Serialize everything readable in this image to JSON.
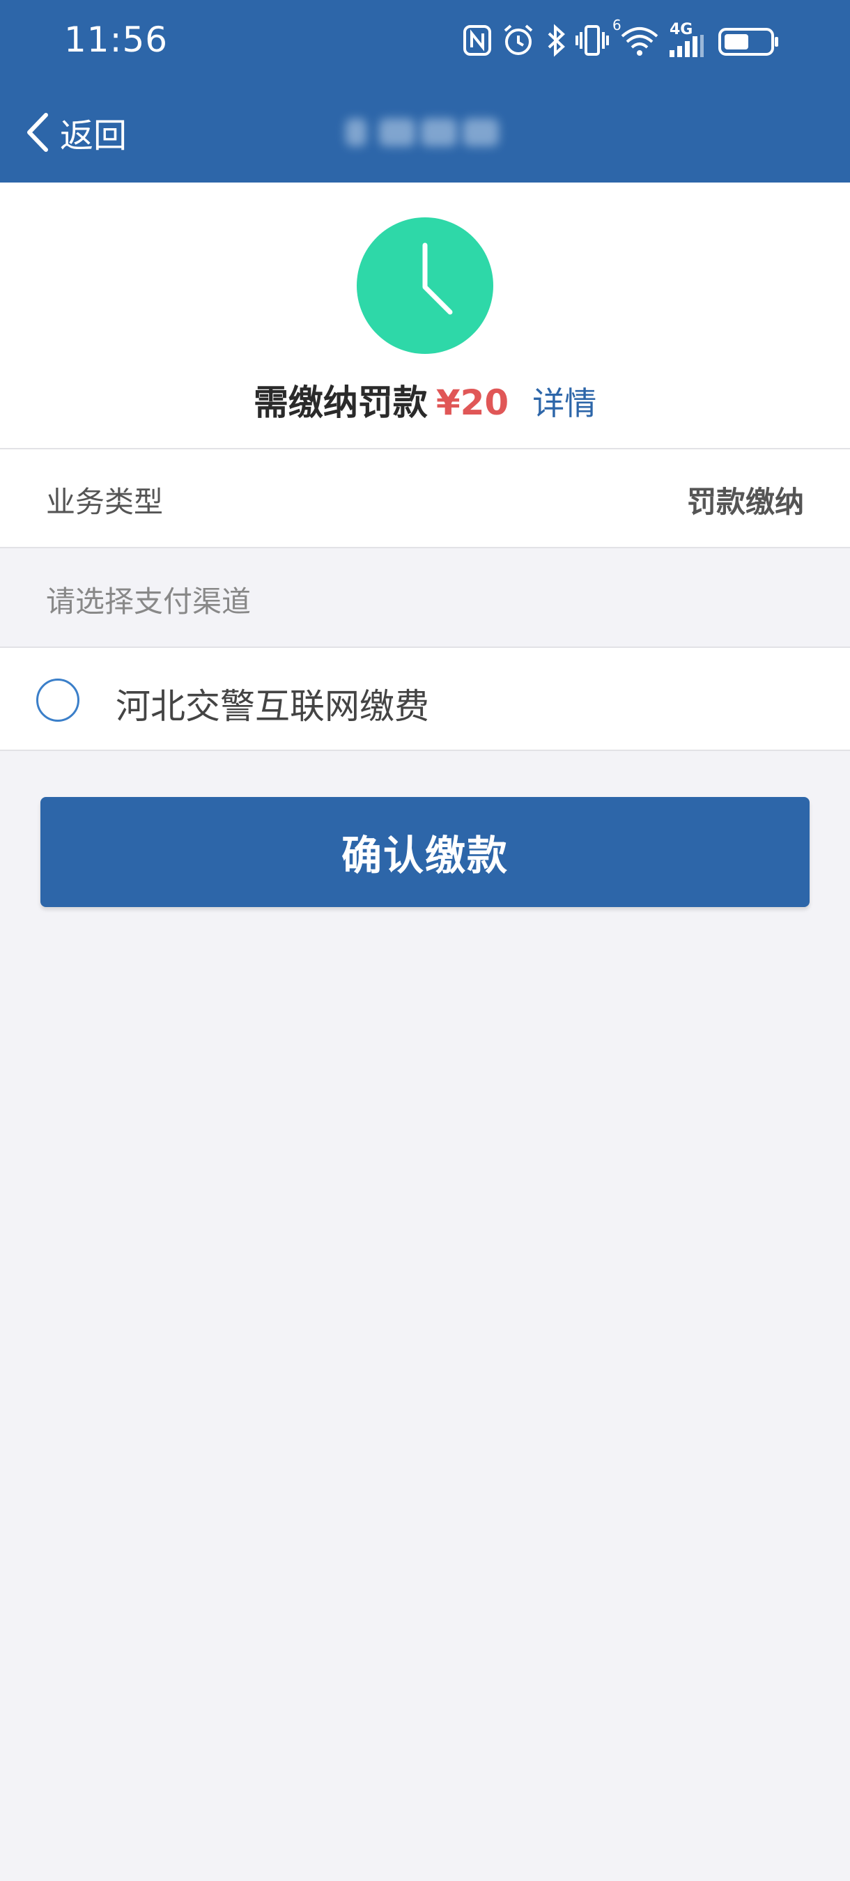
{
  "status_bar": {
    "time": "11:56",
    "network_label": "4G",
    "wifi_badge": "6",
    "icons": [
      "nfc-icon",
      "alarm-icon",
      "bluetooth-icon",
      "vibrate-icon",
      "wifi-icon",
      "signal-icon",
      "battery-icon"
    ]
  },
  "nav": {
    "back_label": "返回"
  },
  "fine": {
    "label": "需缴纳罚款",
    "amount": "¥20",
    "details_label": "详情",
    "icon": "clock-icon"
  },
  "business": {
    "label": "业务类型",
    "value": "罚款缴纳"
  },
  "payment": {
    "section_title": "请选择支付渠道",
    "channels": [
      {
        "label": "河北交警互联网缴费",
        "selected": false
      }
    ]
  },
  "actions": {
    "confirm_label": "确认缴款"
  },
  "colors": {
    "header_bg": "#2d66a9",
    "accent_green": "#2ed8a8",
    "amount_red": "#e05757",
    "page_bg": "#f3f3f7"
  }
}
